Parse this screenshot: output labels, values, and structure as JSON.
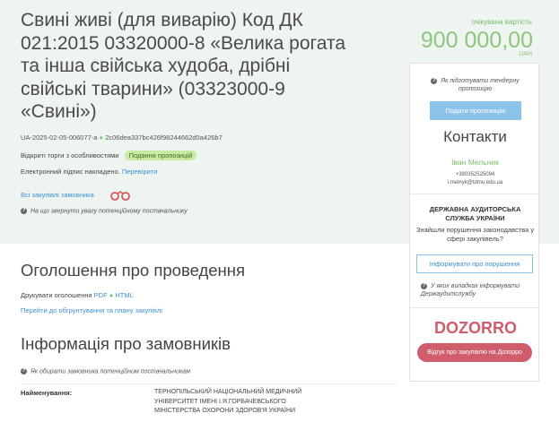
{
  "header": {
    "title": "Свині живі (для виварію) Код ДК 021:2015 03320000-8 «Велика рогата та інша свійська худоба, дрібні свійські тварини» (03323000-9 «Свині»)",
    "tender_id": "UA-2025-02-05-006077-a",
    "hash": "2c06dea337bc426f98244662d0a426b7",
    "procedure_type": "Відкриті торги з особливостями",
    "status_badge": "Подання пропозицій",
    "signature_text": "Електронний підпис накладено.",
    "verify_link": "Перевірити",
    "all_purchases_link": "Всі закупівлі замовника",
    "attention_hint": "На що звернути увагу потенційному постачальнику"
  },
  "price": {
    "label": "очікувана вартість",
    "amount": "900 000,00",
    "currency": "UAH"
  },
  "panel": {
    "prepare_hint": "Як підготувати тендерну пропозицію",
    "submit_button": "Подати пропозицію",
    "contacts_title": "Контакти",
    "contact_name": "Іван Мельник",
    "contact_phone": "+380352525094",
    "contact_email": "i.melnyk@tdmu.edu.ua",
    "audit_title": "ДЕРЖАВНА АУДИТОРСЬКА СЛУЖБА УКРАЇНИ",
    "violation_text": "Знайшли порушення законодавства у сфері закупівель?",
    "inform_button": "Інформувати про порушення",
    "cases_hint": "У яких випадках інформувати Держаудитслужбу",
    "logo_text": "DOZORRO",
    "feedback_button": "Відгук про закупівлю на Дозорро"
  },
  "announcement": {
    "title": "Оголошення про проведення",
    "print_label": "Друкувати оголошення",
    "pdf_link": "PDF",
    "html_link": "HTML",
    "plan_link": "Перейти до обгрунтування та плану закупівлі"
  },
  "customers": {
    "title": "Інформація про замовників",
    "choose_hint": "Як обирати замовника потенційним постачальникам",
    "name_label": "Найменування:",
    "name_value": "ТЕРНОПІЛЬСЬКИЙ НАЦІОНАЛЬНИЙ МЕДИЧНИЙ УНІВЕРСИТЕТ ІМЕНІ І.Я.ГОРБАЧЕВСЬКОГО МІНІСТЕРСТВА ОХОРОНИ ЗДОРОВ'Я УКРАЇНИ"
  },
  "colors": {
    "top_background": "#eef4f0",
    "accent_green": "#8fc47e",
    "link_blue": "#3b8fd6",
    "dozorro_red": "#cf5d6c"
  },
  "icons": {
    "question": "question-circle-icon",
    "handcuffs": "handcuffs-icon"
  }
}
